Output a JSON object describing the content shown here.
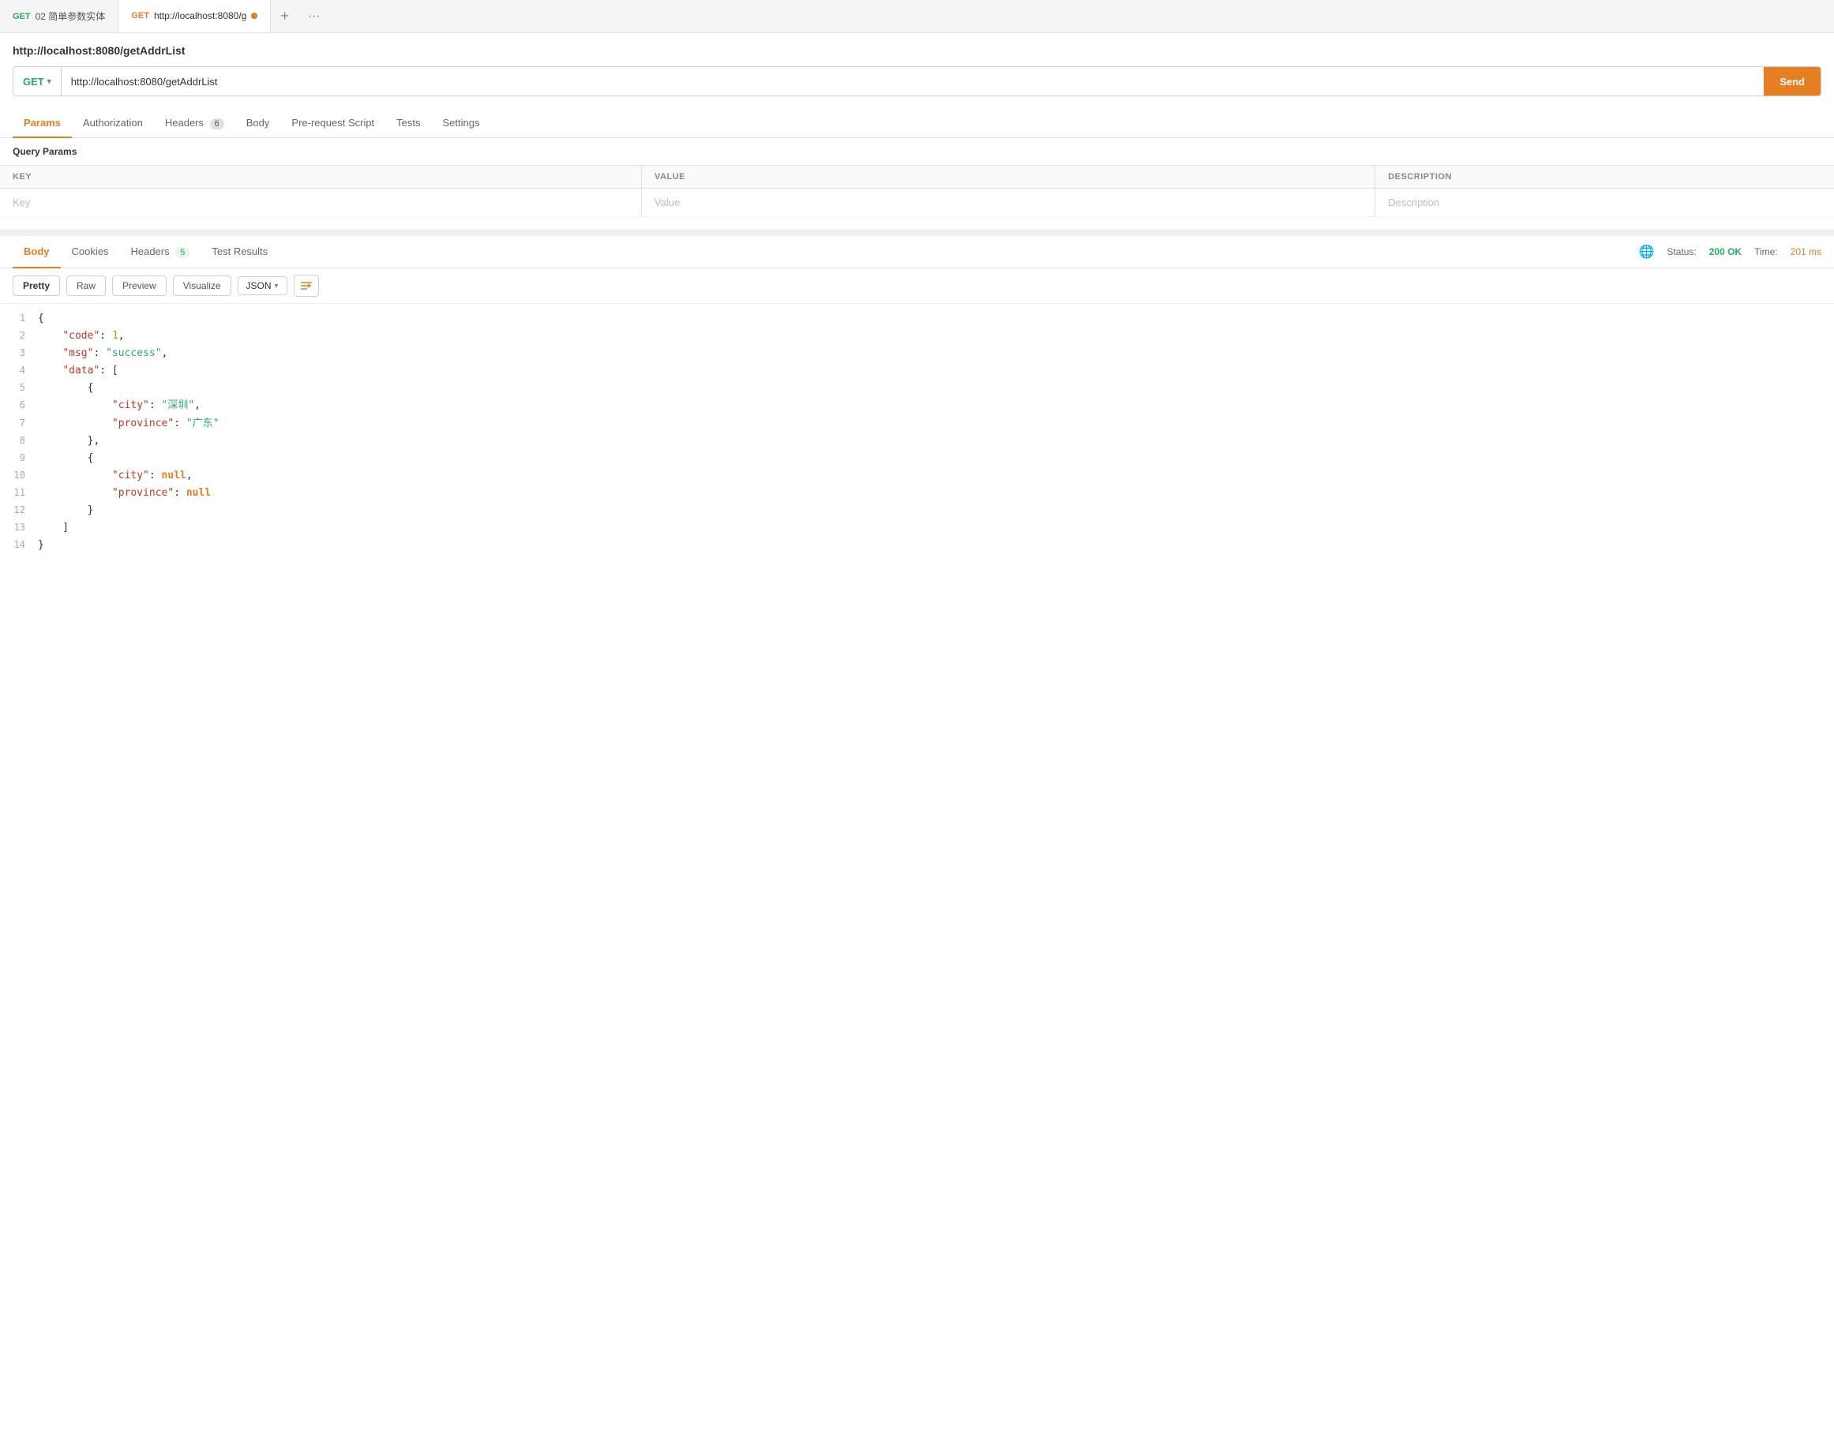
{
  "tabs": [
    {
      "id": "tab1",
      "method": "GET",
      "method_class": "method-get",
      "label": "02 简单参数实体",
      "active": false,
      "dot": false
    },
    {
      "id": "tab2",
      "method": "GET",
      "method_class": "method-get-orange",
      "label": "http://localhost:8080/g",
      "active": true,
      "dot": true
    }
  ],
  "tab_add_label": "+",
  "tab_more_label": "···",
  "page_title": "http://localhost:8080/getAddrList",
  "url_bar": {
    "method": "GET",
    "url": "http://localhost:8080/getAddrList",
    "send_label": "Send"
  },
  "request_tabs": [
    {
      "id": "params",
      "label": "Params",
      "badge": null,
      "active": true
    },
    {
      "id": "authorization",
      "label": "Authorization",
      "badge": null,
      "active": false
    },
    {
      "id": "headers",
      "label": "Headers",
      "badge": "6",
      "active": false
    },
    {
      "id": "body",
      "label": "Body",
      "badge": null,
      "active": false
    },
    {
      "id": "prerequest",
      "label": "Pre-request Script",
      "badge": null,
      "active": false
    },
    {
      "id": "tests",
      "label": "Tests",
      "badge": null,
      "active": false
    },
    {
      "id": "settings",
      "label": "Settings",
      "badge": null,
      "active": false
    }
  ],
  "query_params_label": "Query Params",
  "params_table": {
    "columns": [
      "KEY",
      "VALUE",
      "DESCRIPTION"
    ],
    "rows": [
      {
        "key": "Key",
        "value": "Value",
        "description": "Description"
      }
    ]
  },
  "response_tabs": [
    {
      "id": "body",
      "label": "Body",
      "badge": null,
      "active": true
    },
    {
      "id": "cookies",
      "label": "Cookies",
      "badge": null,
      "active": false
    },
    {
      "id": "headers",
      "label": "Headers",
      "badge": "5",
      "active": false
    },
    {
      "id": "test_results",
      "label": "Test Results",
      "badge": null,
      "active": false
    }
  ],
  "response_status": {
    "status_label": "Status:",
    "status_value": "200 OK",
    "time_label": "Time:",
    "time_value": "201 ms"
  },
  "format_buttons": [
    {
      "id": "pretty",
      "label": "Pretty",
      "active": true
    },
    {
      "id": "raw",
      "label": "Raw",
      "active": false
    },
    {
      "id": "preview",
      "label": "Preview",
      "active": false
    },
    {
      "id": "visualize",
      "label": "Visualize",
      "active": false
    }
  ],
  "json_format": "JSON",
  "json_lines": [
    {
      "num": 1,
      "content": "{",
      "type": "brace"
    },
    {
      "num": 2,
      "content": "\"code\": 1,",
      "type": "keynum",
      "key": "code",
      "num_val": "1"
    },
    {
      "num": 3,
      "content": "\"msg\": \"success\",",
      "type": "keystr",
      "key": "msg",
      "str_val": "success"
    },
    {
      "num": 4,
      "content": "\"data\": [",
      "type": "keyarr",
      "key": "data"
    },
    {
      "num": 5,
      "content": "{",
      "type": "brace"
    },
    {
      "num": 6,
      "content": "\"city\": \"深圳\",",
      "type": "keystr",
      "key": "city",
      "str_val": "深圳"
    },
    {
      "num": 7,
      "content": "\"province\": \"广东\"",
      "type": "keystr",
      "key": "province",
      "str_val": "广东"
    },
    {
      "num": 8,
      "content": "},",
      "type": "brace_close"
    },
    {
      "num": 9,
      "content": "{",
      "type": "brace"
    },
    {
      "num": 10,
      "content": "\"city\": null,",
      "type": "keynull",
      "key": "city"
    },
    {
      "num": 11,
      "content": "\"province\": null",
      "type": "keynull",
      "key": "province"
    },
    {
      "num": 12,
      "content": "}",
      "type": "brace_close"
    },
    {
      "num": 13,
      "content": "]",
      "type": "bracket_close"
    },
    {
      "num": 14,
      "content": "}",
      "type": "brace"
    }
  ]
}
